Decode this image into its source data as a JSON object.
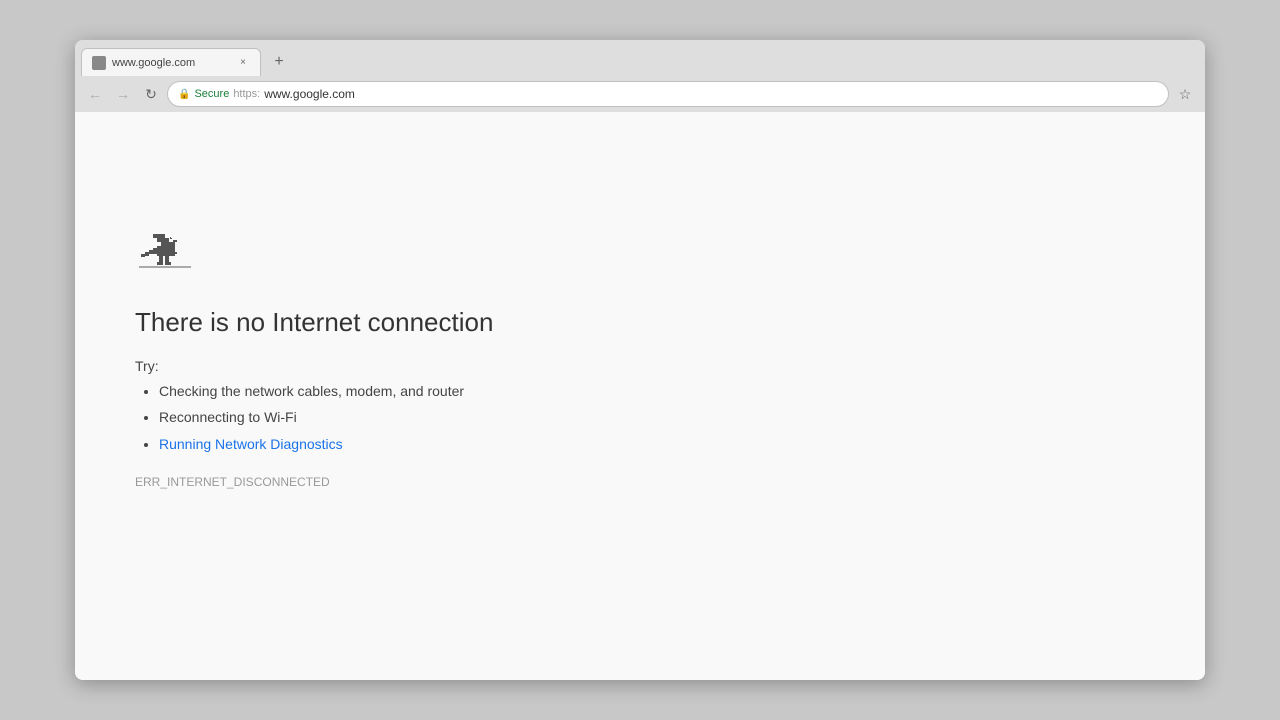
{
  "browser": {
    "tab": {
      "favicon_label": "page-icon",
      "title": "www.google.com",
      "close_label": "×"
    },
    "new_tab_label": "+",
    "nav": {
      "back_label": "←",
      "forward_label": "→",
      "refresh_label": "↻"
    },
    "address_bar": {
      "secure_label": "Secure",
      "url_separator": "https:",
      "url": "www.google.com"
    },
    "star_label": "☆"
  },
  "page": {
    "dino_label": "offline-dinosaur",
    "title": "There is no Internet connection",
    "try_label": "Try:",
    "suggestions": [
      {
        "text": "Checking the network cables, modem, and router",
        "is_link": false
      },
      {
        "text": "Reconnecting to Wi-Fi",
        "is_link": false
      },
      {
        "text": "Running Network Diagnostics",
        "is_link": true
      }
    ],
    "error_code": "ERR_INTERNET_DISCONNECTED"
  }
}
